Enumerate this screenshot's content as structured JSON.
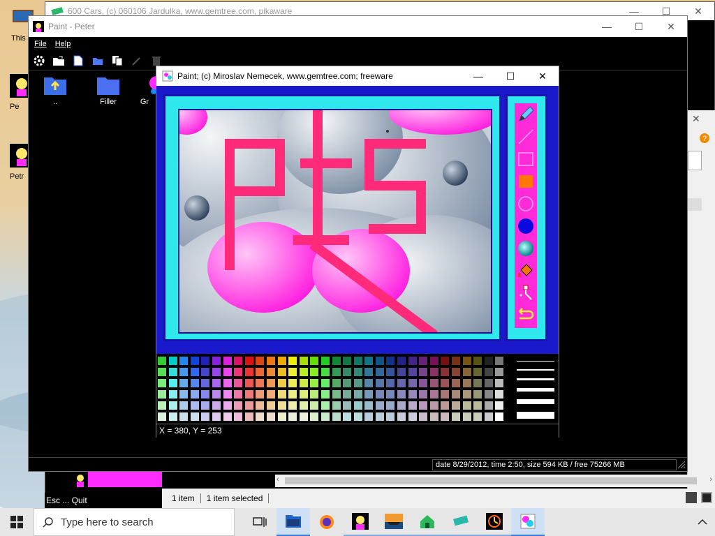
{
  "desktop": {
    "icons": [
      {
        "label": "This"
      },
      {
        "label": "Pe"
      },
      {
        "label": "Petr"
      }
    ]
  },
  "cars_window": {
    "title": "600 Cars, (c) 060106 Jardulka, www.gemtree.com, pikaware",
    "controls": {
      "minimize": "—",
      "maximize": "☐",
      "close": "✕"
    }
  },
  "peter_window": {
    "title": "Paint - Peter",
    "menu": [
      "File",
      "Help"
    ],
    "controls": {
      "minimize": "—",
      "maximize": "☐",
      "close": "✕"
    },
    "files": [
      {
        "label": ".."
      },
      {
        "label": "Filler"
      },
      {
        "label": "Gr"
      }
    ],
    "status": "date 8/29/2012, time 2:50, size 594 KB / free 75266 MB"
  },
  "explorer": {
    "esc_label": "Esc ... Quit",
    "item_count": "1 item",
    "selected": "1 item selected",
    "separator": "|"
  },
  "paint_window": {
    "title": "Paint;  (c) Miroslav Nemecek, www.gemtree.com;  freeware",
    "controls": {
      "minimize": "—",
      "maximize": "☐",
      "close": "✕"
    },
    "status": "X = 380, Y = 253",
    "canvas_text": "PtS",
    "tools": [
      "pencil-icon",
      "line-icon",
      "rectangle-icon",
      "filled-rectangle-icon",
      "circle-icon",
      "filled-circle-icon",
      "sphere-icon",
      "fill-bucket-icon",
      "spray-icon",
      "undo-icon"
    ],
    "palette": [
      "#33cc33",
      "#00cccc",
      "#2288ee",
      "#1144dd",
      "#2222bb",
      "#8822dd",
      "#dd22dd",
      "#dd1166",
      "#dd1111",
      "#dd4411",
      "#ee7711",
      "#eeaa00",
      "#eeee00",
      "#aadd00",
      "#66dd00",
      "#22cc22",
      "#118833",
      "#117744",
      "#117766",
      "#117788",
      "#115588",
      "#113388",
      "#222288",
      "#442288",
      "#662277",
      "#771155",
      "#771111",
      "#773311",
      "#775511",
      "#555511",
      "#222222",
      "#777777",
      "#55dd55",
      "#33dddd",
      "#4499ee",
      "#3366ee",
      "#4444cc",
      "#9944ee",
      "#ee44ee",
      "#ee3377",
      "#ee3333",
      "#ee6633",
      "#ee8833",
      "#eebb22",
      "#eeee33",
      "#bbee22",
      "#88ee22",
      "#44dd44",
      "#339955",
      "#338866",
      "#338877",
      "#337799",
      "#336699",
      "#335599",
      "#444499",
      "#554499",
      "#774488",
      "#883366",
      "#883333",
      "#884433",
      "#886633",
      "#666633",
      "#444444",
      "#999999",
      "#77ee77",
      "#55eeee",
      "#66aaee",
      "#5588ee",
      "#6666dd",
      "#aa66ee",
      "#ee66ee",
      "#ee5599",
      "#ee5555",
      "#ee7755",
      "#ee9955",
      "#eecc44",
      "#eeee55",
      "#ccee44",
      "#99ee44",
      "#66ee66",
      "#55aa66",
      "#559977",
      "#559988",
      "#5588aa",
      "#5577aa",
      "#5566aa",
      "#6666aa",
      "#7766aa",
      "#885599",
      "#995577",
      "#995555",
      "#996655",
      "#997755",
      "#777755",
      "#666666",
      "#bbbbbb",
      "#99ee99",
      "#88eeee",
      "#88bbee",
      "#88aaee",
      "#8888ee",
      "#bb88ee",
      "#ee88ee",
      "#ee77aa",
      "#ee7777",
      "#ee9977",
      "#eeaa77",
      "#eedd77",
      "#eeee88",
      "#ddee77",
      "#bbee77",
      "#88ee88",
      "#77bb88",
      "#77aa99",
      "#77aaaa",
      "#7799bb",
      "#7788bb",
      "#7788bb",
      "#8888bb",
      "#9988bb",
      "#9977aa",
      "#aa7799",
      "#aa7777",
      "#aa8877",
      "#aa9977",
      "#999977",
      "#888888",
      "#dddddd",
      "#bbeebb",
      "#aaeeee",
      "#aaccee",
      "#aabbee",
      "#aaaaee",
      "#ccaaee",
      "#eeaaee",
      "#ee99bb",
      "#ee9999",
      "#eebb99",
      "#eecc99",
      "#eedd99",
      "#eeeeaa",
      "#ddeeaa",
      "#cceeaa",
      "#aaeeaa",
      "#99ccaa",
      "#99bbbb",
      "#99cccc",
      "#99bbcc",
      "#99aacc",
      "#99aacc",
      "#aaaacc",
      "#bbaacc",
      "#bb99bb",
      "#bb99aa",
      "#bb9999",
      "#bbaa99",
      "#bbbb99",
      "#bbbb99",
      "#aaaaaa",
      "#eeeeee",
      "#ddeedd",
      "#cceeee",
      "#ccddee",
      "#ccddee",
      "#ccccee",
      "#ddccee",
      "#eeccee",
      "#eebbdd",
      "#eebbbb",
      "#eeddcc",
      "#eeddcc",
      "#eeeecc",
      "#eeeedd",
      "#eeeedd",
      "#ddeecc",
      "#cceecc",
      "#bbddcc",
      "#bbdddd",
      "#bbdddd",
      "#bbccdd",
      "#bbccdd",
      "#bbccdd",
      "#ccccdd",
      "#ccccdd",
      "#ccbbcc",
      "#ccbbbb",
      "#ccbbbb",
      "#ccccbb",
      "#ccccbb",
      "#ccccbb",
      "#cccccc",
      "#ffffff"
    ]
  },
  "taskbar": {
    "search_placeholder": "Type here to search",
    "tray_chevron": "^"
  }
}
